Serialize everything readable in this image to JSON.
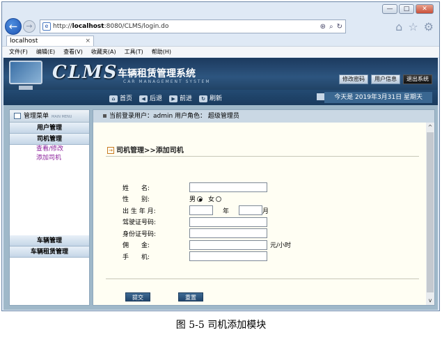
{
  "browser": {
    "url_prefix": "http://",
    "url_host": "localhost",
    "url_rest": ":8080/CLMS/login.do",
    "tab_title": "localhost",
    "menu": [
      "文件(F)",
      "编辑(E)",
      "查看(V)",
      "收藏夹(A)",
      "工具(T)",
      "帮助(H)"
    ]
  },
  "header": {
    "logo": "CLMS",
    "system_name": "车辆租赁管理系统",
    "subtitle": "CAR MANAGEMENT SYSTEM",
    "buttons": [
      "修改密码",
      "用户信息",
      "退出系统"
    ]
  },
  "navbar": {
    "links": [
      "首页",
      "后退",
      "前进",
      "刷新"
    ],
    "date": "今天是 2019年3月31日 星期天"
  },
  "sidebar": {
    "title": "管理菜单",
    "title_en": "MAIN MENU",
    "groups": [
      "用户管理",
      "司机管理",
      "车辆管理",
      "车辆租赁管理"
    ],
    "driver_links": [
      "查看/修改",
      "添加司机"
    ]
  },
  "main": {
    "user_info": "当前登录用户：admin  用户角色：  超级管理员",
    "breadcrumb": "司机管理>>添加司机",
    "fields": {
      "name": "姓　　名:",
      "gender": "性　　别:",
      "male": "男",
      "female": "女",
      "birth": "出 生 年 月:",
      "year": "年",
      "month": "月",
      "license": "驾驶证号码:",
      "idcard": "身份证号码:",
      "commission": "佣　　金:",
      "commission_unit": "元/小时",
      "phone": "手　　机:"
    },
    "submit": "提交",
    "reset": "重置"
  },
  "caption": "图 5-5  司机添加模块"
}
